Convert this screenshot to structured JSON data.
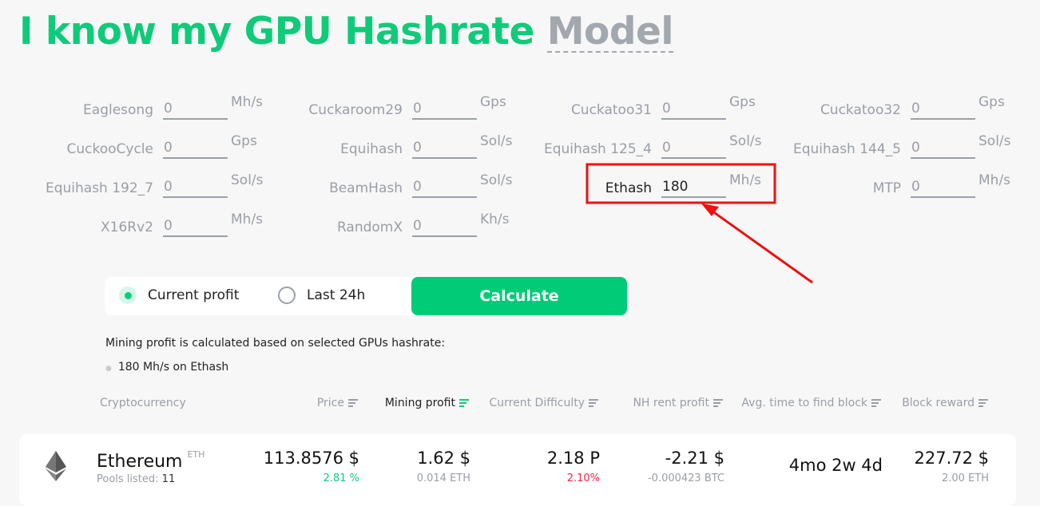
{
  "title": {
    "main": "I know my GPU Hashrate",
    "switch": "Model"
  },
  "algorithms": [
    {
      "label": "Eaglesong",
      "value": "0",
      "unit": "Mh/s"
    },
    {
      "label": "Cuckaroom29",
      "value": "0",
      "unit": "Gps"
    },
    {
      "label": "Cuckatoo31",
      "value": "0",
      "unit": "Gps"
    },
    {
      "label": "Cuckatoo32",
      "value": "0",
      "unit": "Gps"
    },
    {
      "label": "CuckooCycle",
      "value": "0",
      "unit": "Gps"
    },
    {
      "label": "Equihash",
      "value": "0",
      "unit": "Sol/s"
    },
    {
      "label": "Equihash 125_4",
      "value": "0",
      "unit": "Sol/s"
    },
    {
      "label": "Equihash 144_5",
      "value": "0",
      "unit": "Sol/s"
    },
    {
      "label": "Equihash 192_7",
      "value": "0",
      "unit": "Sol/s"
    },
    {
      "label": "BeamHash",
      "value": "0",
      "unit": "Sol/s"
    },
    {
      "label": "Ethash",
      "value": "180",
      "unit": "Mh/s",
      "highlighted": true
    },
    {
      "label": "MTP",
      "value": "0",
      "unit": "Mh/s"
    },
    {
      "label": "X16Rv2",
      "value": "0",
      "unit": "Mh/s"
    },
    {
      "label": "RandomX",
      "value": "0",
      "unit": "Kh/s"
    }
  ],
  "mode": {
    "options": [
      "Current profit",
      "Last 24h"
    ],
    "selected": "Current profit"
  },
  "calculate_label": "Calculate",
  "note": {
    "intro": "Mining profit is calculated based on selected GPUs hashrate:",
    "items": [
      "180 Mh/s on Ethash"
    ]
  },
  "columns": [
    "Cryptocurrency",
    "Price",
    "Mining profit",
    "Current Difficulty",
    "NH rent profit",
    "Avg. time to find block",
    "Block reward"
  ],
  "active_sort": "Mining profit",
  "rows": [
    {
      "name": "Ethereum",
      "ticker": "ETH",
      "pools_label": "Pools listed:",
      "pools": "11",
      "price": "113.8576 $",
      "price_change": "2.81 %",
      "profit": "1.62 $",
      "profit_coin": "0.014 ETH",
      "difficulty": "2.18 P",
      "difficulty_change": "2.10%",
      "nh_profit": "-2.21 $",
      "nh_profit_btc": "-0.000423 BTC",
      "time": "4mo 2w 4d",
      "reward": "227.72 $",
      "reward_coin": "2.00 ETH"
    }
  ],
  "colors": {
    "accent": "#0ecb7a",
    "positive": "#0ecb7a",
    "negative": "#f0244c",
    "highlight_box": "#ee1111"
  }
}
